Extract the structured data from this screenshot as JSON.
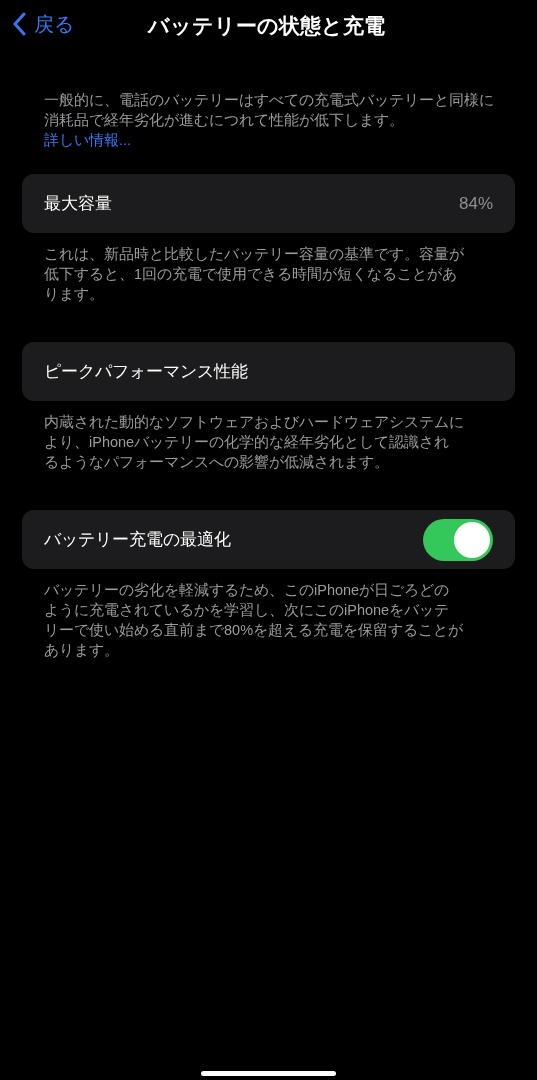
{
  "nav": {
    "back": "戻る",
    "title": "バッテリーの状態と充電"
  },
  "intro": {
    "text": "一般的に、電話のバッテリーはすべての充電式バッテリーと同様に消耗品で経年劣化が進むにつれて性能が低下します。",
    "link": "詳しい情報..."
  },
  "sections": [
    {
      "kind": "value",
      "label": "最大容量",
      "value": "84%",
      "caption": "これは、新品時と比較したバッテリー容量の基準です。容量が低下すると、1回の充電で使用できる時間が短くなることがあります。"
    },
    {
      "kind": "plain",
      "label": "ピークパフォーマンス性能",
      "caption": "内蔵された動的なソフトウェアおよびハードウェアシステムにより、iPhoneバッテリーの化学的な経年劣化として認識されるようなパフォーマンスへの影響が低減されます。"
    },
    {
      "kind": "toggle",
      "label": "バッテリー充電の最適化",
      "on": true,
      "caption": "バッテリーの劣化を軽減するため、このiPhoneが日ごろどのように充電されているかを学習し、次にこのiPhoneをバッテリーで使い始める直前まで80%を超える充電を保留することがあります。"
    }
  ]
}
